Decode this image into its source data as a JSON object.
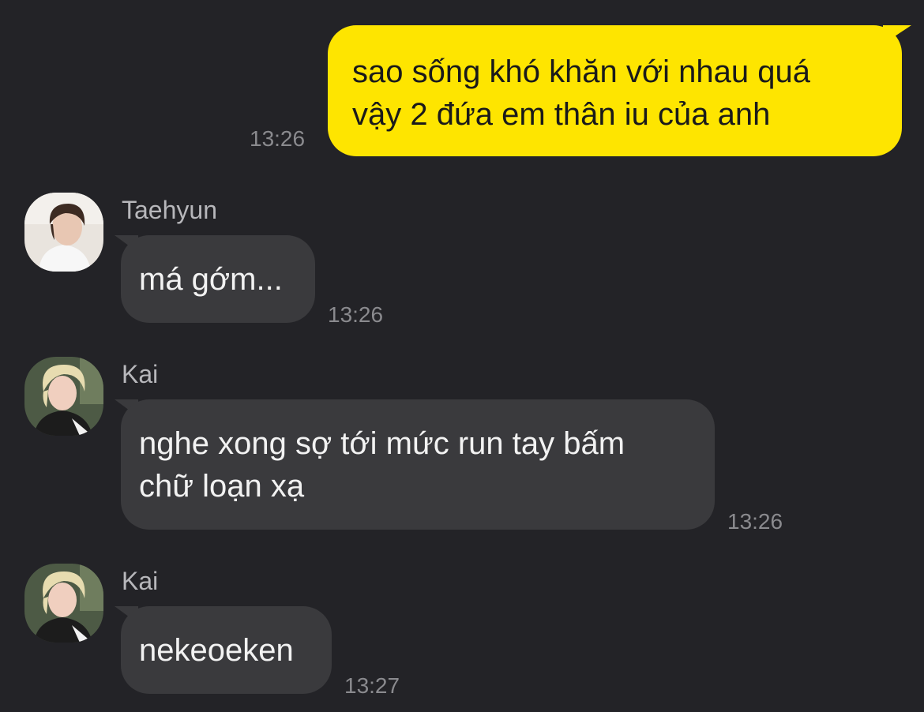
{
  "messages": [
    {
      "direction": "outgoing",
      "lines": [
        "sao sống khó khăn với nhau quá",
        "vậy 2 đứa em thân iu của anh"
      ],
      "time": "13:26"
    },
    {
      "direction": "incoming",
      "sender": "Taehyun",
      "avatar": "taehyun-avatar",
      "lines": [
        "má gớm..."
      ],
      "time": "13:26"
    },
    {
      "direction": "incoming",
      "sender": "Kai",
      "avatar": "kai-avatar",
      "lines": [
        "nghe xong sợ tới mức run tay bấm",
        "chữ loạn xạ"
      ],
      "time": "13:26"
    },
    {
      "direction": "incoming",
      "sender": "Kai",
      "avatar": "kai-avatar",
      "lines": [
        "nekeoeken"
      ],
      "time": "13:27"
    }
  ],
  "colors": {
    "background": "#232327",
    "outgoing_bubble": "#FEE500",
    "incoming_bubble": "#3A3A3D",
    "timestamp": "#8A8A8E",
    "sender_name": "#B7B7BB"
  }
}
